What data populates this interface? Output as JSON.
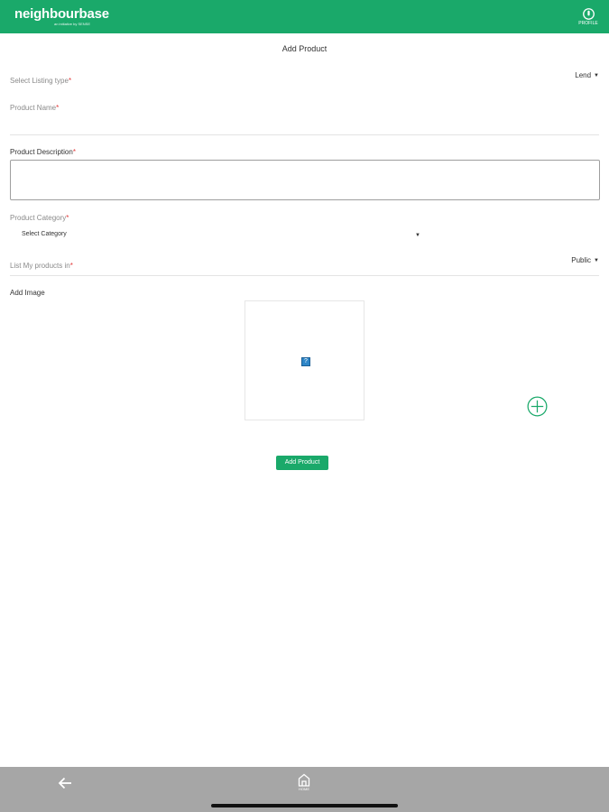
{
  "header": {
    "logo": "neighbourbase",
    "tagline": "an initiative by SENSE",
    "profile_label": "PROFILE",
    "bg_color": "#1aa96a"
  },
  "page": {
    "title": "Add Product"
  },
  "form": {
    "listing_type": {
      "label": "Select Listing type",
      "required_mark": "*",
      "value": "Lend"
    },
    "product_name": {
      "label": "Product Name",
      "required_mark": "*",
      "value": ""
    },
    "product_description": {
      "label": "Product Description",
      "required_mark": "*",
      "value": ""
    },
    "product_category": {
      "label": "Product Category",
      "required_mark": "*",
      "value": "Select Category"
    },
    "list_in": {
      "label": "List My products in",
      "required_mark": "*",
      "value": "Public"
    },
    "add_image": {
      "label": "Add Image"
    },
    "submit_label": "Add Product"
  },
  "icons": {
    "profile": "user-icon",
    "caret": "chevron-down-icon",
    "broken_image": "image-placeholder-icon",
    "add_image": "add-circle-icon",
    "back": "arrow-left-icon",
    "home": "home-icon"
  },
  "bottom_nav": {
    "home_label": "HOME"
  }
}
